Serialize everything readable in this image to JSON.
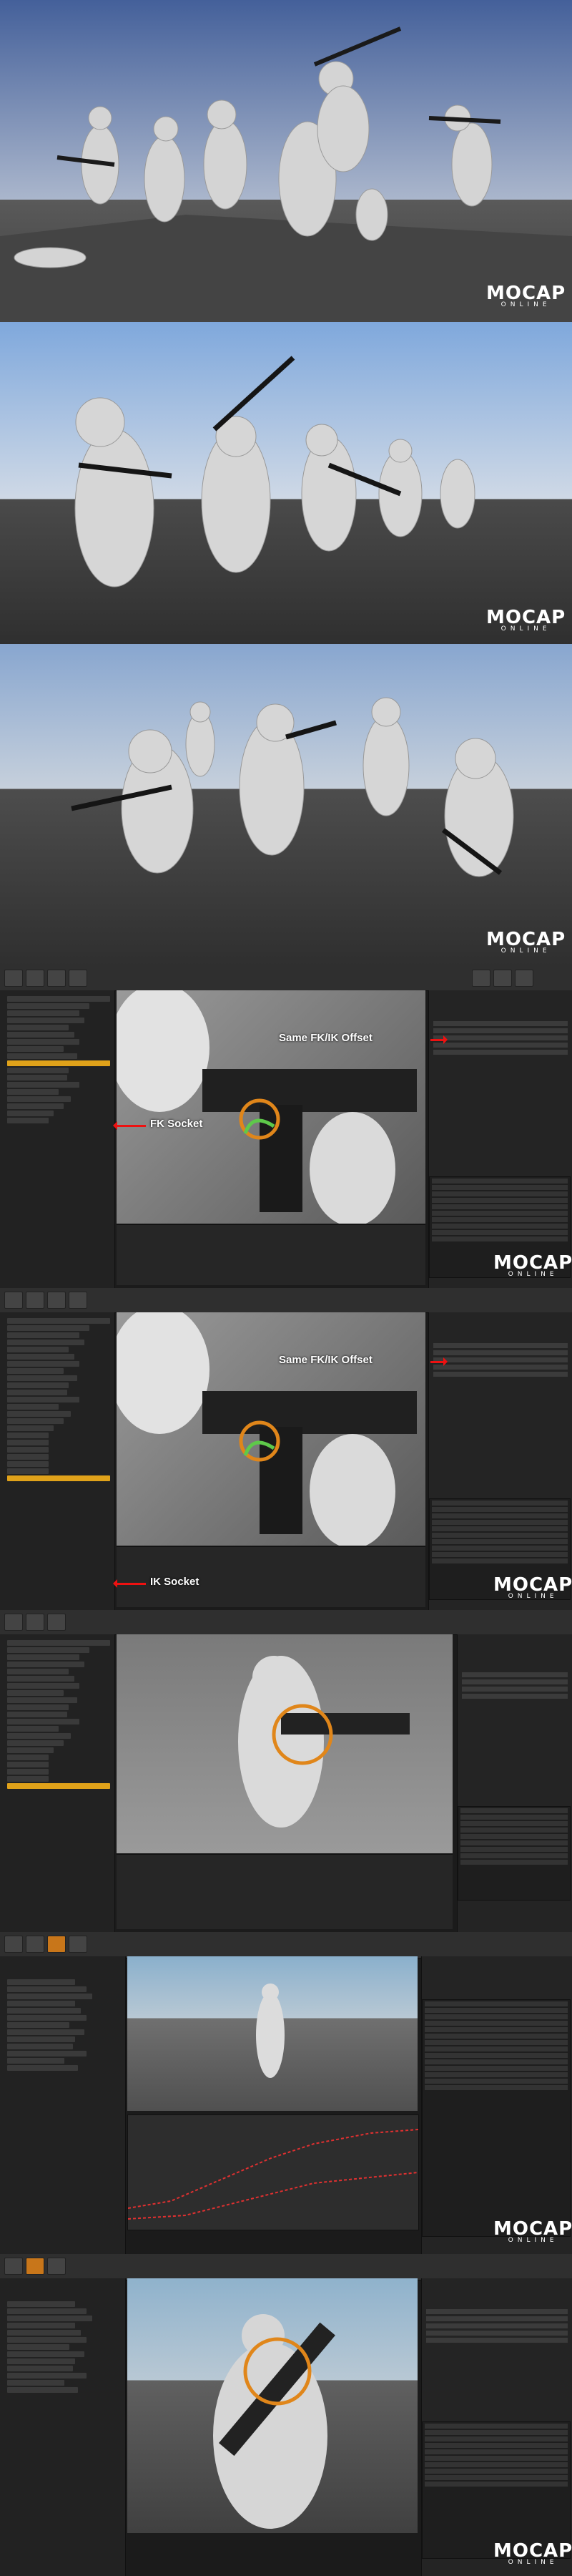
{
  "logo": {
    "brand": "MOCAP",
    "brand_o": "O",
    "sub": "ONLINE",
    "heart": "♥"
  },
  "callouts": {
    "offset_label_1": "Same FK/IK Offset",
    "fk_label": "FK Socket",
    "offset_label_2": "Same FK/IK Offset",
    "ik_label": "IK Socket"
  },
  "colors": {
    "brand_red": "#e2242a",
    "highlight": "#e0a21a",
    "arrow": "#e11111"
  }
}
